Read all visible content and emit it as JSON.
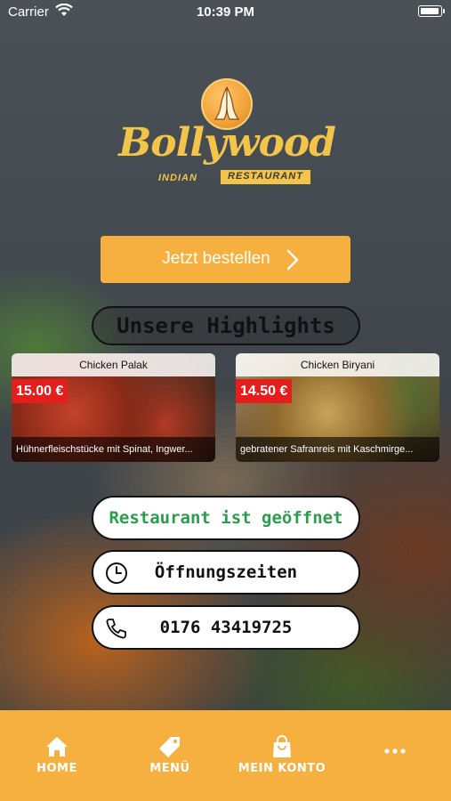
{
  "status_bar": {
    "carrier": "Carrier",
    "time": "10:39 PM"
  },
  "logo": {
    "title": "Bollywood",
    "subtitle_left": "INDIAN",
    "subtitle_right": "RESTAURANT"
  },
  "order_button": {
    "label": "Jetzt bestellen"
  },
  "highlights": {
    "heading": "Unsere Highlights",
    "items": [
      {
        "name": "Chicken Palak",
        "price": "15.00 €",
        "description": "Hühnerfleischstücke mit Spinat, Ingwer..."
      },
      {
        "name": "Chicken Biryani",
        "price": "14.50 €",
        "description": "gebratener Safranreis mit Kaschmirge..."
      }
    ]
  },
  "status_pill": {
    "label": "Restaurant ist geöffnet",
    "color": "#2a9e4d"
  },
  "hours_pill": {
    "label": "Öffnungszeiten",
    "icon": "clock-icon"
  },
  "phone_pill": {
    "label": "0176 43419725",
    "icon": "phone-icon"
  },
  "tab_bar": {
    "background": "#f6b03f",
    "tabs": [
      {
        "label": "HOME",
        "icon": "home-icon"
      },
      {
        "label": "MENÜ",
        "icon": "tag-icon"
      },
      {
        "label": "MEIN KONTO",
        "icon": "shopping-bag-icon"
      },
      {
        "label": "",
        "icon": "more-dots-icon"
      }
    ]
  },
  "accent_color": "#f6b03f",
  "price_badge_color": "#e51d1d"
}
